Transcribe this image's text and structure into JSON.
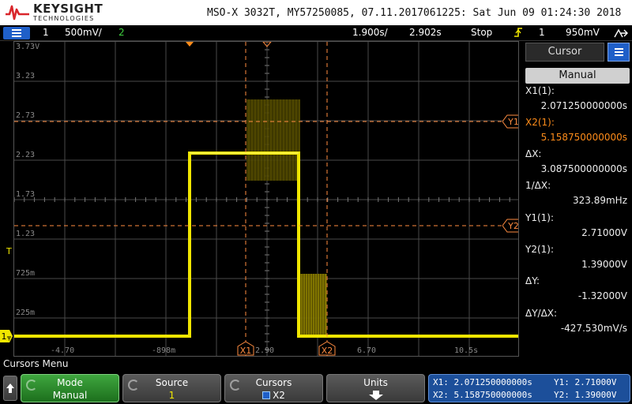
{
  "header": {
    "brand": "KEYSIGHT",
    "brand_sub": "TECHNOLOGIES",
    "title": "MSO-X 3032T, MY57250085, 07.11.2017061225: Sat Jun 09 01:24:30 2018"
  },
  "status": {
    "ch1_num": "1",
    "ch1_scale": "500mV/",
    "ch2_num": "2",
    "timebase": "1.900s/",
    "delay": "2.902s",
    "run_state": "Stop",
    "trig_source": "1",
    "trig_level": "950mV"
  },
  "grid": {
    "y_labels": [
      "3.73V",
      "3.23",
      "2.73",
      "2.23",
      "1.73",
      "1.23",
      "725m",
      "225m"
    ],
    "x_labels": [
      "-4.70",
      "-898m",
      "2.90",
      "6.70",
      "10.5s"
    ],
    "cursor_x1_tag": "X1",
    "cursor_x2_tag": "X2",
    "cursor_y1_tag": "Y1",
    "cursor_y2_tag": "Y2",
    "trigger_marker": "T",
    "channel_marker": "1",
    "colors": {
      "trace": "#f0e600",
      "cursor": "#ff8c40",
      "grid": "#4a4a4a"
    }
  },
  "cursor_panel": {
    "title": "Cursor",
    "mode": "Manual",
    "x1_label": "X1(1):",
    "x1_value": "2.071250000000s",
    "x2_label": "X2(1):",
    "x2_value": "5.158750000000s",
    "dx_label": "ΔX:",
    "dx_value": "3.087500000000s",
    "inv_dx_label": "1/ΔX:",
    "inv_dx_value": "323.89mHz",
    "y1_label": "Y1(1):",
    "y1_value": "2.71000V",
    "y2_label": "Y2(1):",
    "y2_value": "1.39000V",
    "dy_label": "ΔY:",
    "dy_value": "-1.32000V",
    "dydx_label": "ΔY/ΔX:",
    "dydx_value": "-427.530mV/s"
  },
  "softkeys": {
    "menu_title": "Cursors Menu",
    "mode_label": "Mode",
    "mode_value": "Manual",
    "source_label": "Source",
    "source_value": "1",
    "cursors_label": "Cursors",
    "cursors_value": "X2",
    "units_label": "Units",
    "readout_x1": "X1: 2.071250000000s",
    "readout_x2": "X2: 5.158750000000s",
    "readout_y1": "Y1: 2.71000V",
    "readout_y2": "Y2: 1.39000V"
  }
}
